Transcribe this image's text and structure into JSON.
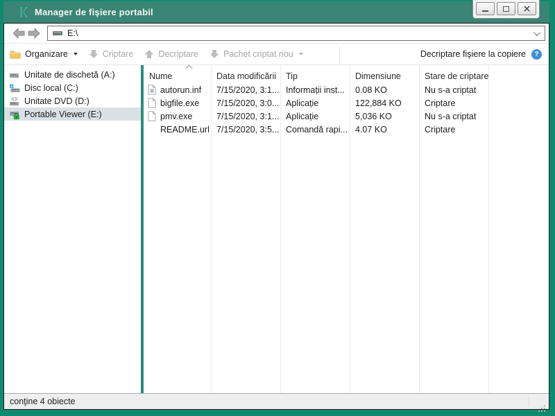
{
  "colors": {
    "window_border": "#0f8a6f",
    "titlebar": "#3a8575",
    "logo_teal": "#3fae93",
    "splitter": "#2c8e78",
    "selection": "#d9e1e7",
    "help_blue": "#3f8fd9",
    "folder_yellow": "#f6c863",
    "lock_green": "#27a844",
    "disabled_text": "#a6a6a6"
  },
  "titlebar": {
    "title": "Manager de fişiere portabil",
    "controls": [
      "minimize",
      "maximize",
      "close"
    ]
  },
  "navbar": {
    "back_icon": "back-arrow-icon",
    "forward_icon": "forward-arrow-icon",
    "address_value": "E:\\",
    "address_icon": "drive-icon"
  },
  "toolbar": {
    "organize": "Organizare",
    "encrypt": "Criptare",
    "decrypt": "Decriptare",
    "new_encrypted_package": "Pachet criptat nou",
    "decrypt_on_copy": "Decriptare fişiere la copiere",
    "help_glyph": "?"
  },
  "sidebar": {
    "items": [
      {
        "label": "Unitate de dischetă (A:)",
        "icon": "floppy-drive-icon",
        "selected": false
      },
      {
        "label": "Disc local (C:)",
        "icon": "local-disk-icon",
        "selected": false
      },
      {
        "label": "Unitate DVD (D:)",
        "icon": "dvd-drive-icon",
        "selected": false
      },
      {
        "label": "Portable Viewer (E:)",
        "icon": "locked-portable-drive-icon",
        "selected": true
      }
    ]
  },
  "filelist": {
    "columns": {
      "name": "Nume",
      "modified": "Data modificării",
      "type": "Tip",
      "size": "Dimensiune",
      "status": "Stare de criptare"
    },
    "sort": {
      "column": "name",
      "direction": "ascending"
    },
    "rows": [
      {
        "icon": "setup-information-file-icon",
        "name": "autorun.inf",
        "modified": "7/15/2020, 3:1...",
        "type": "Informații inst...",
        "size": "0.08 KO",
        "status": "Nu s-a criptat"
      },
      {
        "icon": "generic-file-icon",
        "name": "bigfile.exe",
        "modified": "7/15/2020, 3:0...",
        "type": "Aplicație",
        "size": "122,884 KO",
        "status": "Criptare"
      },
      {
        "icon": "generic-file-icon",
        "name": "pmv.exe",
        "modified": "7/15/2020, 3:1...",
        "type": "Aplicație",
        "size": "5,036 KO",
        "status": "Nu s-a criptat"
      },
      {
        "icon": "none",
        "name": "README.url",
        "modified": "7/15/2020, 3:5...",
        "type": "Comandă rapi...",
        "size": "4.07 KO",
        "status": "Criptare"
      }
    ]
  },
  "statusbar": {
    "text": "conţine 4 obiecte"
  }
}
